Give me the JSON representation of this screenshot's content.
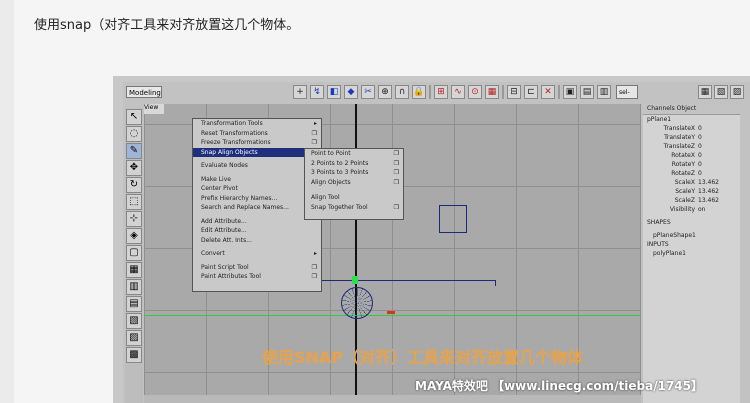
{
  "article": {
    "text": "使用snap（对齐工具来对齐放置这几个物体。"
  },
  "maya": {
    "mode": "Modeling",
    "panel_menu": "View",
    "selection_field": "sel-",
    "toolbar_icons": [
      "plus-icon",
      "curve-icon",
      "cube-icon",
      "sphere-icon",
      "scissor-icon",
      "grid-icon",
      "magnet-icon",
      "lock-icon",
      "snap-grid-icon",
      "snap-curve-icon",
      "snap-point-icon",
      "snap-plane-icon",
      "history-icon",
      "render-icon",
      "ipr-icon",
      "render-globals-icon"
    ],
    "menu": {
      "items": [
        {
          "label": "Transformation Tools",
          "has_arrow": true
        },
        {
          "label": "Reset Transformations",
          "has_option": true
        },
        {
          "label": "Freeze Transformations",
          "has_option": true
        },
        {
          "label": "Snap Align Objects",
          "has_arrow": true,
          "highlighted": true
        },
        {
          "label": "Evaluate Nodes",
          "has_arrow": true,
          "gap": true
        },
        {
          "label": "Make Live",
          "gap": true
        },
        {
          "label": "Center Pivot"
        },
        {
          "label": "Prefix Hierarchy Names...",
          "has_option": false
        },
        {
          "label": "Search and Replace Names..."
        },
        {
          "label": "Add Attribute...",
          "gap": true
        },
        {
          "label": "Edit Attribute..."
        },
        {
          "label": "Delete Att. Ints..."
        },
        {
          "label": "Convert",
          "has_arrow": true,
          "gap": true
        },
        {
          "label": "Paint Script Tool",
          "has_option": true,
          "gap": true
        },
        {
          "label": "Paint Attributes Tool",
          "has_option": true
        }
      ]
    },
    "submenu": {
      "items": [
        {
          "label": "Point to Point",
          "has_option": true
        },
        {
          "label": "2 Points to 2 Points",
          "has_option": true
        },
        {
          "label": "3 Points to 3 Points",
          "has_option": true
        },
        {
          "label": "Align Objects",
          "has_option": true
        },
        {
          "label": "Align Tool",
          "gap": true
        },
        {
          "label": "Snap Together Tool",
          "has_option": true
        }
      ]
    },
    "channel_box": {
      "header": "Channels Object",
      "object": "pPlane1",
      "attributes": [
        {
          "name": "TranslateX",
          "value": "0"
        },
        {
          "name": "TranslateY",
          "value": "0"
        },
        {
          "name": "TranslateZ",
          "value": "0"
        },
        {
          "name": "RotateX",
          "value": "0"
        },
        {
          "name": "RotateY",
          "value": "0"
        },
        {
          "name": "RotateZ",
          "value": "0"
        },
        {
          "name": "ScaleX",
          "value": "13.462"
        },
        {
          "name": "ScaleY",
          "value": "13.462"
        },
        {
          "name": "ScaleZ",
          "value": "13.462"
        },
        {
          "name": "Visibility",
          "value": "on"
        }
      ],
      "shapes_label": "SHAPES",
      "shape_name": "pPlaneShape1",
      "inputs_label": "INPUTS",
      "input_name": "polyPlane1"
    },
    "caption": "使用SNAP（对齐）工具来对齐放置几个物体",
    "watermark": "MAYA特效吧 【www.linecg.com/tieba/1745】"
  },
  "colors": {
    "menu_highlight": "#1f2f7e",
    "pivot_green": "#2ee04d",
    "caption_orange": "#e8a34a",
    "wire_blue": "#1a2b7a"
  }
}
